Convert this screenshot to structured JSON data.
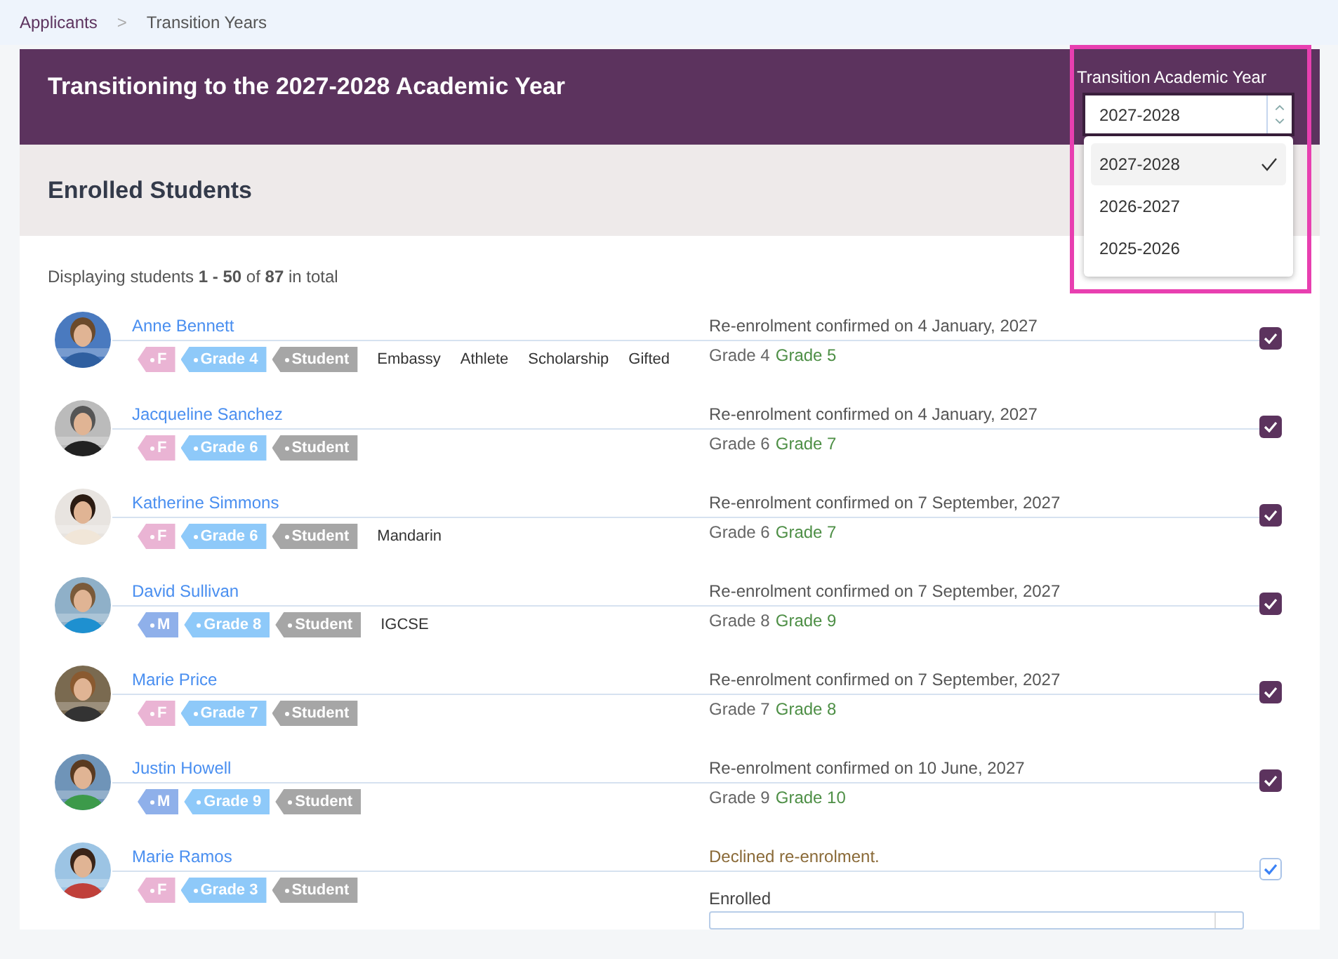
{
  "breadcrumb": [
    {
      "label": "Applicants",
      "kind": "link"
    },
    {
      "label": ">",
      "kind": "separator"
    },
    {
      "label": "Transition Years",
      "kind": "current"
    }
  ],
  "header": {
    "title": "Transitioning to the 2027-2028 Academic Year"
  },
  "year_picker": {
    "label": "Transition Academic Year",
    "value": "2027-2028",
    "expanded": true,
    "options": [
      {
        "label": "2027-2028",
        "selected": true
      },
      {
        "label": "2026-2027",
        "selected": false
      },
      {
        "label": "2025-2026",
        "selected": false
      }
    ]
  },
  "section": {
    "title": "Enrolled Students"
  },
  "summary": "Displaying students **1 - 50** of **87** in total",
  "students": [
    {
      "name": "Anne Bennett",
      "tags": [
        {
          "label": "F",
          "color": "#eab4d4"
        },
        {
          "label": "Grade 4",
          "color": "#8ec9f9"
        },
        {
          "label": "Student",
          "color": "#a6a6a6"
        }
      ],
      "labels": [
        "Embassy",
        "Athlete",
        "Scholarship",
        "Gifted"
      ],
      "status": {
        "kind": "confirmed",
        "text": "Re-enrolment confirmed on 4 January, 2027",
        "from": "Grade 4",
        "to": "Grade 5"
      },
      "checked": true
    },
    {
      "name": "Jacqueline Sanchez",
      "tags": [
        {
          "label": "F",
          "color": "#eab4d4"
        },
        {
          "label": "Grade 6",
          "color": "#8ec9f9"
        },
        {
          "label": "Student",
          "color": "#a6a6a6"
        }
      ],
      "status": {
        "kind": "confirmed",
        "text": "Re-enrolment confirmed on 4 January, 2027",
        "from": "Grade 6",
        "to": "Grade 7"
      },
      "checked": true
    },
    {
      "name": "Katherine Simmons",
      "tags": [
        {
          "label": "F",
          "color": "#eab4d4"
        },
        {
          "label": "Grade 6",
          "color": "#8ec9f9"
        },
        {
          "label": "Student",
          "color": "#a6a6a6"
        }
      ],
      "labels": [
        "Mandarin"
      ],
      "status": {
        "kind": "confirmed",
        "text": "Re-enrolment confirmed on 7 September, 2027",
        "from": "Grade 6",
        "to": "Grade 7"
      },
      "checked": true
    },
    {
      "name": "David Sullivan",
      "tags": [
        {
          "label": "M",
          "color": "#8fb0ea"
        },
        {
          "label": "Grade 8",
          "color": "#8ec9f9"
        },
        {
          "label": "Student",
          "color": "#a6a6a6"
        }
      ],
      "labels": [
        "IGCSE"
      ],
      "status": {
        "kind": "confirmed",
        "text": "Re-enrolment confirmed on 7 September, 2027",
        "from": "Grade 8",
        "to": "Grade 9"
      },
      "checked": true
    },
    {
      "name": "Marie Price",
      "tags": [
        {
          "label": "F",
          "color": "#eab4d4"
        },
        {
          "label": "Grade 7",
          "color": "#8ec9f9"
        },
        {
          "label": "Student",
          "color": "#a6a6a6"
        }
      ],
      "status": {
        "kind": "confirmed",
        "text": "Re-enrolment confirmed on 7 September, 2027",
        "from": "Grade 7",
        "to": "Grade 8"
      },
      "checked": true
    },
    {
      "name": "Justin Howell",
      "tags": [
        {
          "label": "M",
          "color": "#8fb0ea"
        },
        {
          "label": "Grade 9",
          "color": "#8ec9f9"
        },
        {
          "label": "Student",
          "color": "#a6a6a6"
        }
      ],
      "status": {
        "kind": "confirmed",
        "text": "Re-enrolment confirmed on 10 June, 2027",
        "from": "Grade 9",
        "to": "Grade 10"
      },
      "checked": true
    },
    {
      "name": "Marie Ramos",
      "tags": [
        {
          "label": "F",
          "color": "#eab4d4"
        },
        {
          "label": "Grade 3",
          "color": "#8ec9f9"
        },
        {
          "label": "Student",
          "color": "#a6a6a6"
        }
      ],
      "status": {
        "kind": "declined",
        "text": "Declined re-enrolment.",
        "field_label": "Enrolled"
      },
      "checked": true
    }
  ]
}
